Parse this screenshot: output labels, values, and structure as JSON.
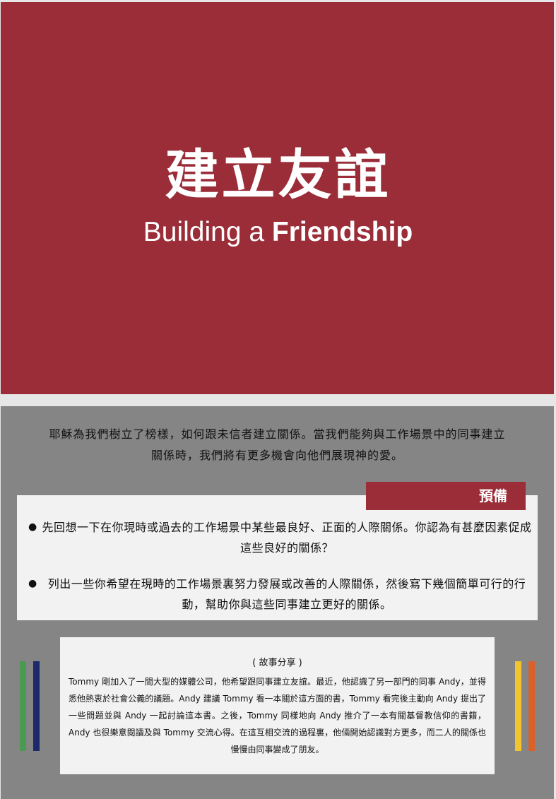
{
  "hero": {
    "title_zh": "建立友誼",
    "title_en_regular": "Building a ",
    "title_en_bold": "Friendship"
  },
  "intro": {
    "line1": "耶穌為我們樹立了榜樣，如何跟未信者建立關係。當我們能夠與工作場景中的同事建立",
    "line2": "關係時，我們將有更多機會向他們展現神的愛。"
  },
  "prepare": {
    "tag": "預備",
    "items": [
      "先回想一下在你現時或過去的工作場景中某些最良好、正面的人際關係。你認為有甚麼因素促成這些良好的關係？",
      "列出一些你希望在現時的工作場景裏努力發展或改善的人際關係，然後寫下幾個簡單可行的行動，幫助你與這些同事建立更好的關係。"
    ]
  },
  "story": {
    "heading": "( 故事分享 )",
    "body": "Tommy 剛加入了一間大型的媒體公司，他希望跟同事建立友誼。最近，他認識了另一部門的同事 Andy，並得悉他熱衷於社會公義的議題。Andy 建議 Tommy 看一本關於這方面的書，Tommy 看完後主動向 Andy 提出了一些問題並與 Andy 一起討論這本書。之後，Tommy 同樣地向 Andy 推介了一本有關基督教信仰的書籍，Andy 也很樂意閱讀及與 Tommy 交流心得。在這互相交流的過程裏，他倆開始認識對方更多，而二人的關係也慢慢由同事變成了朋友。"
  },
  "colors": {
    "accent": "#9b2d38",
    "panel": "#858585",
    "card": "#f2f2f2",
    "stripe_green": "#4a9a52",
    "stripe_navy": "#1c2a6b",
    "stripe_yellow": "#f2c530",
    "stripe_orange": "#d9622b"
  }
}
